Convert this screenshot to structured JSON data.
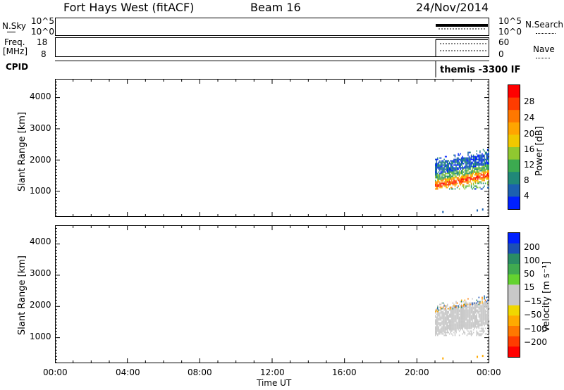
{
  "header": {
    "station": "Fort Hays West (fitACF)",
    "beam": "Beam 16",
    "date": "24/Nov/2014"
  },
  "strip_panels": {
    "nsky": {
      "left_label": "N.Sky",
      "right_label": "N.Search",
      "left_ticks": [
        "10^5",
        "10^0"
      ],
      "right_ticks": [
        "10^5",
        "10^0"
      ]
    },
    "freq": {
      "left_label_top": "Freq.",
      "left_label_bottom": "[MHz]",
      "right_label": "Nave",
      "left_ticks": [
        "18",
        "8"
      ],
      "right_ticks": [
        "60",
        "0"
      ]
    },
    "cpid": {
      "label": "CPID",
      "mode_text": "themis -3300 IF"
    }
  },
  "x_axis": {
    "label": "Time UT",
    "ticks": [
      "00:00",
      "04:00",
      "08:00",
      "12:00",
      "16:00",
      "20:00",
      "00:00"
    ]
  },
  "power_panel": {
    "ylabel": "Slant Range [km]",
    "colorbar_label": "Power [dB]",
    "colorbar_ticks": [
      "28",
      "24",
      "20",
      "16",
      "12",
      "8",
      "4"
    ],
    "colorbar_colors": [
      "#ff0000",
      "#ff3c00",
      "#ff7800",
      "#ffa500",
      "#f0c800",
      "#90c830",
      "#3caa50",
      "#208878",
      "#1c60b0",
      "#0020ff"
    ]
  },
  "velocity_panel": {
    "ylabel": "Slant Range [km]",
    "colorbar_label": "Velocity [m s⁻¹]",
    "colorbar_ticks": [
      "200",
      "100",
      "50",
      "15",
      "−15",
      "−50",
      "−100",
      "−200"
    ],
    "colorbar_colors": [
      "#0020ff",
      "#1c50b4",
      "#2a8c64",
      "#40aa50",
      "#64d230",
      "#c8c8c8",
      "#c8c8c8",
      "#f0d700",
      "#ffaa00",
      "#ff7800",
      "#ff3c00",
      "#ff0000"
    ]
  },
  "chart_data": [
    {
      "type": "heatmap",
      "title": "Power [dB]",
      "xlabel": "Time UT",
      "ylabel": "Slant Range [km]",
      "xlim": [
        "00:00",
        "24:00"
      ],
      "ylim": [
        180,
        4600
      ],
      "yticks": [
        1000,
        2000,
        3000,
        4000
      ],
      "color_scale": [
        0,
        30
      ],
      "data_window": {
        "x_start": "21:00",
        "x_end": "24:00",
        "range_min_km": 1000,
        "range_max_km": 2300
      },
      "series": [
        {
          "name": "strong echo band (20-28 dB)",
          "x": [
            "21:00",
            "22:00",
            "23:00",
            "24:00"
          ],
          "range_km": [
            1150,
            1250,
            1350,
            1500
          ]
        },
        {
          "name": "weak echo band (4-12 dB)",
          "x": [
            "21:00",
            "22:00",
            "23:00",
            "24:00"
          ],
          "range_km": [
            1700,
            1800,
            1900,
            2100
          ]
        }
      ]
    },
    {
      "type": "heatmap",
      "title": "Velocity [m s⁻¹]",
      "xlabel": "Time UT",
      "ylabel": "Slant Range [km]",
      "xlim": [
        "00:00",
        "24:00"
      ],
      "ylim": [
        180,
        4600
      ],
      "yticks": [
        1000,
        2000,
        3000,
        4000
      ],
      "color_scale": [
        -250,
        250
      ],
      "data_window": {
        "x_start": "21:00",
        "x_end": "24:00",
        "range_min_km": 1000,
        "range_max_km": 2300
      },
      "dominant_velocity_range": [
        -15,
        15
      ]
    }
  ]
}
